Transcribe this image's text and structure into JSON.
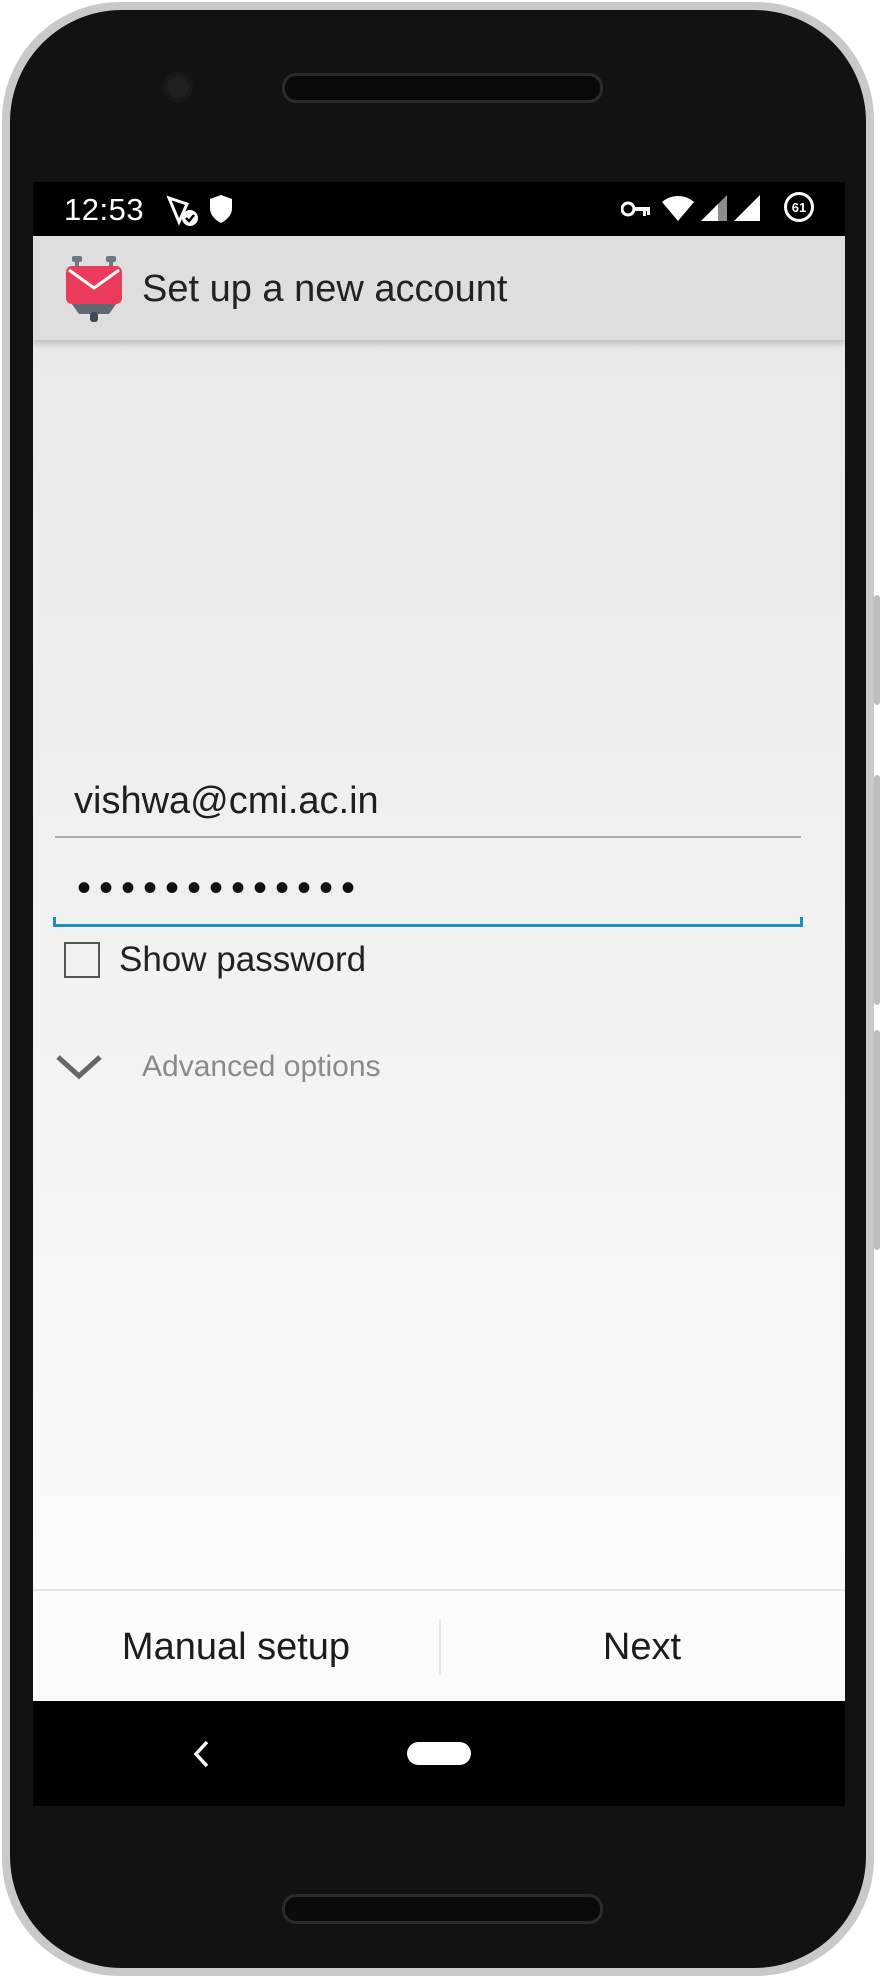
{
  "status_bar": {
    "time": "12:53",
    "battery_level": "61",
    "icons": [
      "satellite-check-icon",
      "shield-icon",
      "vpn-key-icon",
      "wifi-icon",
      "signal-icon",
      "signal-icon",
      "battery-icon"
    ]
  },
  "app_bar": {
    "title": "Set up a new account",
    "logo": "k9-mail-logo"
  },
  "form": {
    "email_value": "vishwa@cmi.ac.in",
    "password_masked": "•••••••••••••",
    "show_password_label": "Show password",
    "show_password_checked": false,
    "advanced_options_label": "Advanced options"
  },
  "bottom_bar": {
    "manual_setup_label": "Manual setup",
    "next_label": "Next"
  },
  "colors": {
    "accent": "#1e8fbf",
    "app_bar": "#dedede",
    "logo_red": "#ec3a5a"
  }
}
